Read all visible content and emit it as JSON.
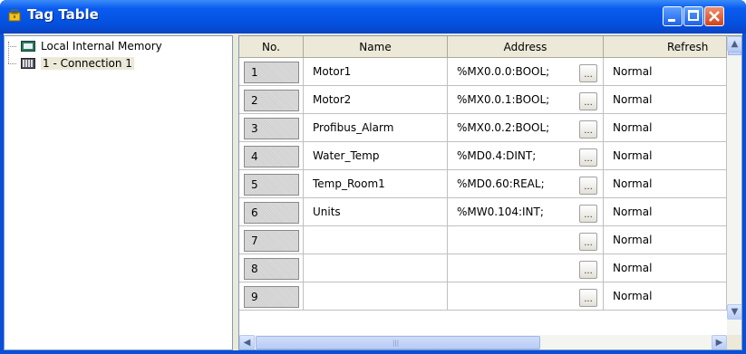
{
  "window": {
    "title": "Tag Table",
    "title_icon": "tag-table-icon"
  },
  "tree": {
    "items": [
      {
        "label": "Local Internal Memory",
        "icon": "memory-icon"
      },
      {
        "label": "1 - Connection 1",
        "icon": "connection-icon",
        "selected": true
      }
    ]
  },
  "table": {
    "columns": [
      "No.",
      "Name",
      "Address",
      "Refresh"
    ],
    "rows": [
      {
        "no": "1",
        "name": "Motor1",
        "address": "%MX0.0.0:BOOL;",
        "refresh": "Normal"
      },
      {
        "no": "2",
        "name": "Motor2",
        "address": "%MX0.0.1:BOOL;",
        "refresh": "Normal"
      },
      {
        "no": "3",
        "name": "Profibus_Alarm",
        "address": "%MX0.0.2:BOOL;",
        "refresh": "Normal"
      },
      {
        "no": "4",
        "name": "Water_Temp",
        "address": "%MD0.4:DINT;",
        "refresh": "Normal"
      },
      {
        "no": "5",
        "name": "Temp_Room1",
        "address": "%MD0.60:REAL;",
        "refresh": "Normal"
      },
      {
        "no": "6",
        "name": "Units",
        "address": "%MW0.104:INT;",
        "refresh": "Normal"
      },
      {
        "no": "7",
        "name": "",
        "address": "",
        "refresh": "Normal"
      },
      {
        "no": "8",
        "name": "",
        "address": "",
        "refresh": "Normal"
      },
      {
        "no": "9",
        "name": "",
        "address": "",
        "refresh": "Normal"
      }
    ],
    "browse_label": "..."
  }
}
